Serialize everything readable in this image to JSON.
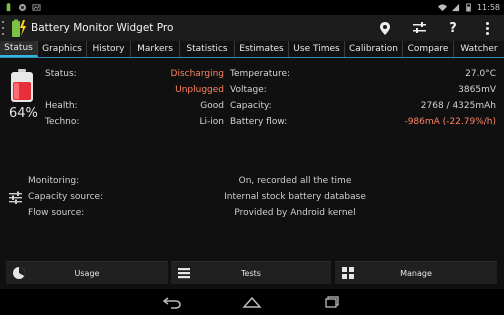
{
  "statusbar": {
    "time": "11:58"
  },
  "app": {
    "title": "Battery Monitor Widget Pro"
  },
  "tabs": [
    {
      "label": "Status"
    },
    {
      "label": "Graphics"
    },
    {
      "label": "History"
    },
    {
      "label": "Markers"
    },
    {
      "label": "Statistics"
    },
    {
      "label": "Estimates"
    },
    {
      "label": "Use Times"
    },
    {
      "label": "Calibration"
    },
    {
      "label": "Compare"
    },
    {
      "label": "Watcher"
    }
  ],
  "status": {
    "percent": "64%",
    "left": [
      {
        "label": "Status:",
        "value": "Discharging"
      },
      {
        "label": "",
        "value": "Unplugged"
      },
      {
        "label": "Health:",
        "value": "Good"
      },
      {
        "label": "Techno:",
        "value": "Li-ion"
      }
    ],
    "right": [
      {
        "label": "Temperature:",
        "value": "27.0°C"
      },
      {
        "label": "Voltage:",
        "value": "3865mV"
      },
      {
        "label": "Capacity:",
        "value": "2768 / 4325mAh"
      },
      {
        "label": "Battery flow:",
        "value": "-986mA (-22.79%/h)"
      }
    ]
  },
  "info": [
    {
      "label": "Monitoring:",
      "value": "On, recorded all the time"
    },
    {
      "label": "Capacity source:",
      "value": "Internal stock battery database"
    },
    {
      "label": "Flow source:",
      "value": "Provided by Android kernel"
    }
  ],
  "buttons": {
    "usage": "Usage",
    "tests": "Tests",
    "manage": "Manage"
  },
  "colors": {
    "accent": "#33b5e5",
    "warning": "#ff8262",
    "battery": "#e8303a"
  }
}
